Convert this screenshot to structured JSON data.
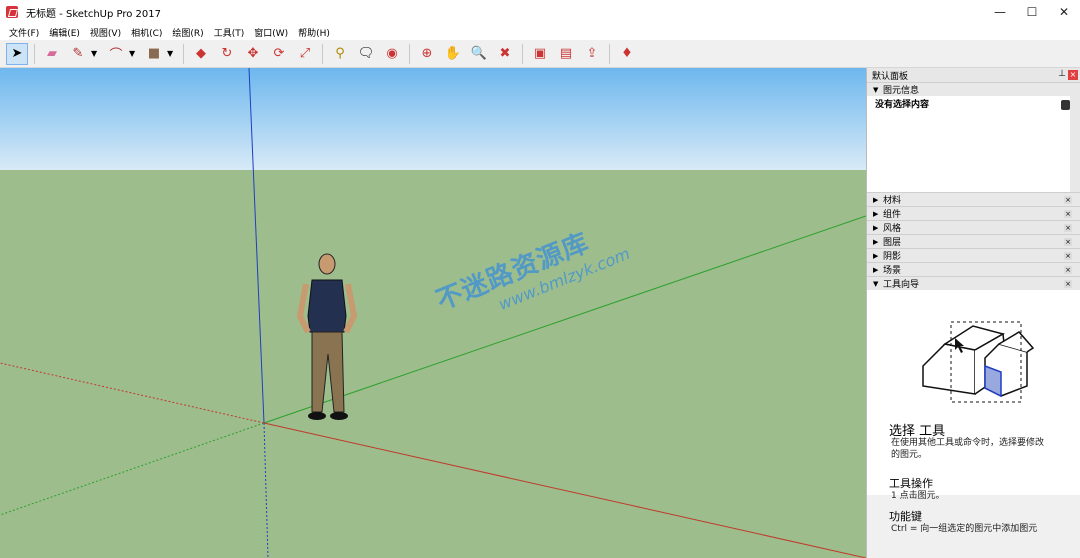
{
  "window": {
    "title": "无标题 - SketchUp Pro 2017",
    "controls": [
      "—",
      "☐",
      "✕"
    ]
  },
  "menu": [
    "文件(F)",
    "编辑(E)",
    "视图(V)",
    "相机(C)",
    "绘图(R)",
    "工具(T)",
    "窗口(W)",
    "帮助(H)"
  ],
  "toolbar": {
    "tools": [
      "select-tool",
      "eraser-tool",
      "pencil-tool",
      "arc-tool",
      "rectangle-tool",
      "pushpull-tool",
      "followme-tool",
      "move-tool",
      "rotate-tool",
      "scale-tool",
      "tape-tool",
      "text-tool",
      "paint-tool",
      "orbit-tool",
      "pan-tool",
      "zoom-tool",
      "zoom-extents-tool",
      "warehouse-tool",
      "share-tool",
      "upload-tool",
      "ruby-tool"
    ]
  },
  "panel": {
    "title": "默认面板",
    "entity_tray": "图元信息",
    "entity_status": "没有选择内容",
    "trays": [
      "材料",
      "组件",
      "风格",
      "图层",
      "阴影",
      "场景"
    ],
    "instructor_tray": "工具向导",
    "instructor": {
      "tool_name": "选择 工具",
      "description": "在使用其他工具或命令时，选择要修改的图元。",
      "ops_heading": "工具操作",
      "ops_step": "1  点击图元。",
      "keys_heading": "功能键",
      "keys_line": "Ctrl = 向一组选定的图元中添加图元"
    }
  },
  "watermark": {
    "line1": "不迷路资源库",
    "line2": "www.bmlzyk.com"
  },
  "colors": {
    "sky_top": "#6db7ee",
    "ground": "#9dbd8d",
    "axis_red": "#c0392b",
    "axis_green": "#2ca02c",
    "axis_blue": "#1f3fbf"
  }
}
